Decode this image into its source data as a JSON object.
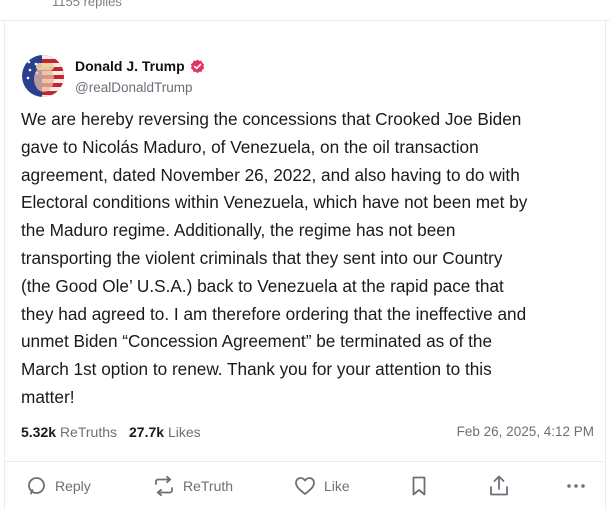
{
  "previous": {
    "replies_text": "1155 replies"
  },
  "post": {
    "author": {
      "display_name": "Donald J. Trump",
      "handle": "@realDonaldTrump"
    },
    "text": "We are hereby reversing the concessions that Crooked Joe Biden\ngave to Nicolás Maduro, of Venezuela, on the oil transaction\nagreement, dated November 26, 2022, and also having to do with\nElectoral conditions within Venezuela, which have not been met by\nthe Maduro regime. Additionally, the regime has not been\ntransporting the violent criminals that they sent into our Country\n(the Good Ole’ U.S.A.) back to Venezuela at the rapid pace that\nthey had agreed to. I am therefore ordering that the ineffective and\nunmet Biden “Concession Agreement” be terminated as of the\nMarch 1st option to renew. Thank you for your attention to this\nmatter!",
    "stats": {
      "retruths_count": "5.32k",
      "retruths_label": "ReTruths",
      "likes_count": "27.7k",
      "likes_label": "Likes"
    },
    "timestamp": "Feb 26, 2025, 4:12 PM"
  },
  "actions": {
    "reply_label": "Reply",
    "retruth_label": "ReTruth",
    "like_label": "Like",
    "bookmark_icon": "bookmark-icon",
    "share_icon": "share-icon",
    "more_icon": "more-icon"
  },
  "colors": {
    "verified": "#e0345f",
    "muted_text": "#6b7078",
    "divider": "#ececef"
  }
}
